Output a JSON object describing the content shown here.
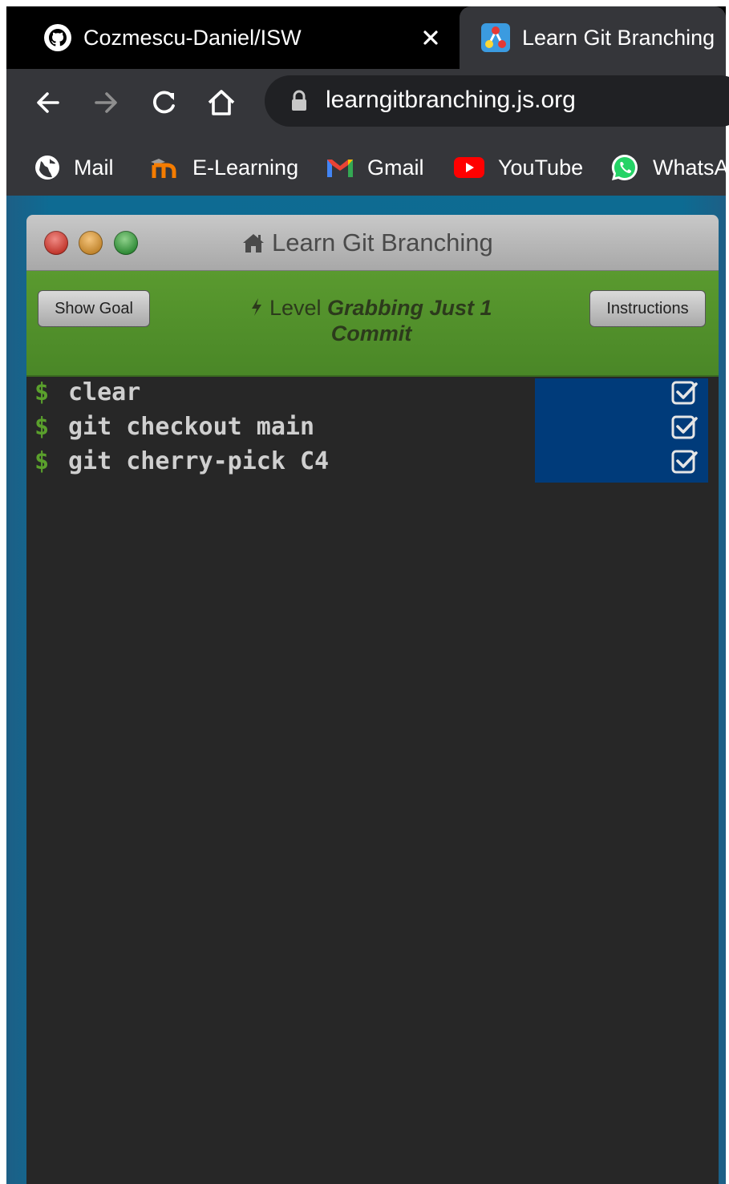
{
  "browser": {
    "tabs": [
      {
        "label": "Cozmescu-Daniel/ISW",
        "icon": "github-icon",
        "active": false
      },
      {
        "label": "Learn Git Branching",
        "icon": "learngit-favicon-icon",
        "active": true
      }
    ],
    "url": "learngitbranching.js.org",
    "bookmarks": [
      {
        "label": "Mail",
        "icon": "globe-icon"
      },
      {
        "label": "E-Learning",
        "icon": "moodle-icon"
      },
      {
        "label": "Gmail",
        "icon": "gmail-icon"
      },
      {
        "label": "YouTube",
        "icon": "youtube-icon"
      },
      {
        "label": "WhatsA",
        "icon": "whatsapp-icon"
      }
    ]
  },
  "app": {
    "window_title": "Learn Git Branching",
    "show_goal_label": "Show Goal",
    "instructions_label": "Instructions",
    "level_prefix": "Level",
    "level_name": "Grabbing Just 1 Commit",
    "prompt_symbol": "$",
    "commands": [
      {
        "text": "clear",
        "status": "done"
      },
      {
        "text": "git checkout main",
        "status": "done"
      },
      {
        "text": "git cherry-pick C4",
        "status": "done"
      }
    ]
  },
  "colors": {
    "level_bar": "#4f8a2a",
    "terminal_bg": "#272727",
    "prompt": "#5aa02c",
    "status_bg": "#003b7a",
    "page_bg": "#0d6b92"
  }
}
